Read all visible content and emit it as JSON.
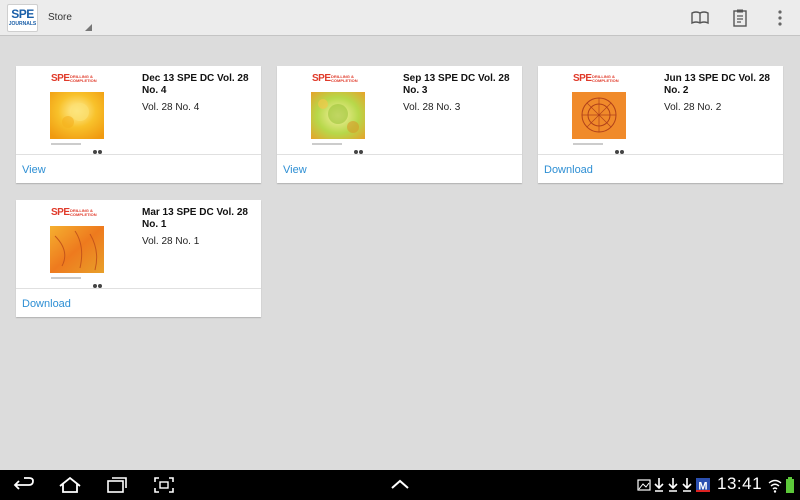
{
  "app": {
    "logo_line1": "SPE",
    "logo_line2": "JOURNALS",
    "nav_title": "Store",
    "actions": [
      "library-icon",
      "clipboard-icon",
      "overflow-menu-icon"
    ]
  },
  "cover": {
    "brand": "SPE",
    "journal": "DRILLING & COMPLETION"
  },
  "issues": [
    {
      "title": "Dec 13 SPE DC Vol. 28 No. 4",
      "volume": "Vol. 28 No. 4",
      "action": "View"
    },
    {
      "title": "Sep 13 SPE DC Vol. 28 No. 3",
      "volume": "Vol. 28 No. 3",
      "action": "View"
    },
    {
      "title": "Jun 13 SPE DC Vol. 28 No. 2",
      "volume": "Vol. 28 No. 2",
      "action": "Download"
    },
    {
      "title": "Mar 13 SPE DC Vol. 28 No. 1",
      "volume": "Vol. 28 No. 1",
      "action": "Download"
    }
  ],
  "status_bar": {
    "time": "13:41",
    "icons": [
      "gallery-icon",
      "download-icon",
      "download-icon",
      "download-icon",
      "m-app-icon",
      "wifi-icon",
      "battery-icon"
    ]
  },
  "colors": {
    "accent": "#2e8fd4",
    "brand_red": "#e03a2a",
    "brand_blue": "#1a5fa8",
    "background": "#dcdcdc"
  }
}
